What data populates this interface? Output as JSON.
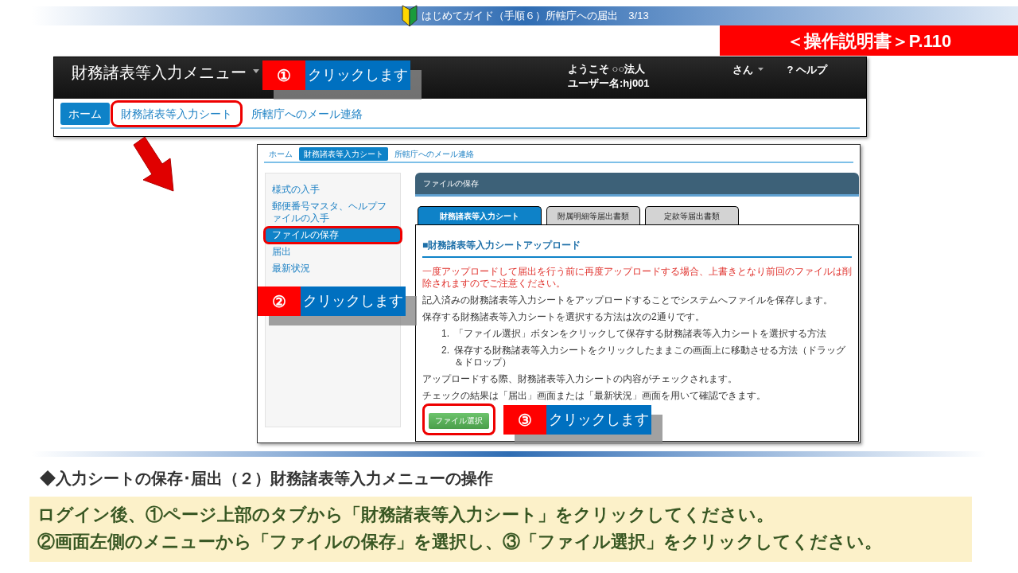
{
  "header": {
    "title": "はじめてガイド（手順６）所轄庁への届出　3/13"
  },
  "manual_ref": "＜操作説明書＞P.110",
  "screen1": {
    "app_title": "財務諸表等入力メニュー",
    "welcome": "ようこそ ○○法人",
    "user": "ユーザー名:hj001",
    "user_menu": "さん",
    "help_mark": "?",
    "help": "ヘルプ",
    "tabs": [
      {
        "label": "ホーム",
        "selected": true,
        "highlighted": false
      },
      {
        "label": "財務諸表等入力シート",
        "selected": false,
        "highlighted": true
      },
      {
        "label": "所轄庁へのメール連絡",
        "selected": false,
        "highlighted": false
      }
    ],
    "callout": {
      "number": "①",
      "text": "クリックします"
    }
  },
  "screen2": {
    "tabs": [
      {
        "label": "ホーム",
        "selected": false
      },
      {
        "label": "財務諸表等入力シート",
        "selected": true
      },
      {
        "label": "所轄庁へのメール連絡",
        "selected": false
      }
    ],
    "sidebar": [
      {
        "label": "様式の入手",
        "selected": false,
        "highlighted": false
      },
      {
        "label": "郵便番号マスタ、ヘルプファイルの入手",
        "selected": false,
        "highlighted": false
      },
      {
        "label": "ファイルの保存",
        "selected": true,
        "highlighted": true
      },
      {
        "label": "届出",
        "selected": false,
        "highlighted": false
      },
      {
        "label": "最新状況",
        "selected": false,
        "highlighted": false
      }
    ],
    "sidebar_callout": {
      "number": "②",
      "text": "クリックします"
    },
    "panel_title": "ファイルの保存",
    "subtabs": [
      {
        "label": "財務諸表等入力シート",
        "selected": true
      },
      {
        "label": "附属明細等届出書類",
        "selected": false
      },
      {
        "label": "定款等届出書類",
        "selected": false
      }
    ],
    "section_title": "■財務諸表等入力シートアップロード",
    "content": [
      {
        "kind": "warning",
        "text": "一度アップロードして届出を行う前に再度アップロードする場合、上書きとなり前回のファイルは削除されますのでご注意ください。"
      },
      {
        "kind": "paragraph",
        "text": "記入済みの財務諸表等入力シートをアップロードすることでシステムへファイルを保存します。"
      },
      {
        "kind": "paragraph",
        "text": "保存する財務諸表等入力シートを選択する方法は次の2通りです。"
      },
      {
        "kind": "step",
        "number": "1.",
        "text": "「ファイル選択」ボタンをクリックして保存する財務諸表等入力シートを選択する方法"
      },
      {
        "kind": "step",
        "number": "2.",
        "text": "保存する財務諸表等入力シートをクリックしたままこの画面上に移動させる方法（ドラッグ＆ドロップ）"
      },
      {
        "kind": "paragraph",
        "text": "アップロードする際、財務諸表等入力シートの内容がチェックされます。"
      },
      {
        "kind": "paragraph",
        "text": "チェックの結果は「届出」画面または「最新状況」画面を用いて確認できます。"
      }
    ],
    "button": {
      "label": "ファイル選択",
      "highlighted": true
    },
    "button_callout": {
      "number": "③",
      "text": "クリックします"
    }
  },
  "heading": "◆入力シートの保存･届出（２）財務諸表等入力メニューの操作",
  "instructions": [
    "ログイン後、①ページ上部のタブから「財務諸表等入力シート」をクリックしてください。",
    "②画面左側のメニューから「ファイルの保存」を選択し、③「ファイル選択」をクリックしてください。"
  ]
}
